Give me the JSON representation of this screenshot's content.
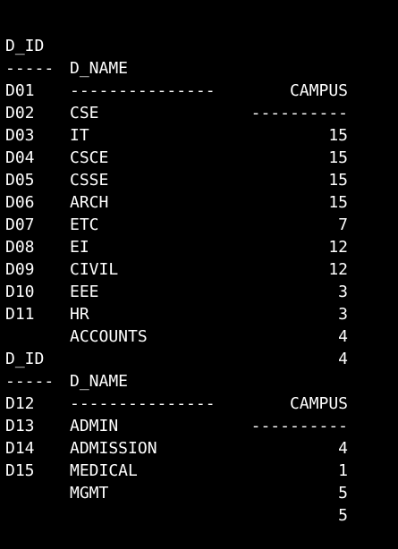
{
  "colors": {
    "background": "#000000",
    "text": "#ffffff"
  },
  "result_sets": [
    {
      "header": {
        "id": "D_ID",
        "name": "D_NAME",
        "campus": "CAMPUS"
      },
      "separator": {
        "id": "-----",
        "name": "---------------",
        "campus": "----------"
      },
      "rows": [
        {
          "id": "D01",
          "name": "CSE",
          "campus": "15"
        },
        {
          "id": "D02",
          "name": "IT",
          "campus": "15"
        },
        {
          "id": "D03",
          "name": "CSCE",
          "campus": "15"
        },
        {
          "id": "D04",
          "name": "CSSE",
          "campus": "15"
        },
        {
          "id": "D05",
          "name": "ARCH",
          "campus": "7"
        },
        {
          "id": "D06",
          "name": "ETC",
          "campus": "12"
        },
        {
          "id": "D07",
          "name": "EI",
          "campus": "12"
        },
        {
          "id": "D08",
          "name": "CIVIL",
          "campus": "3"
        },
        {
          "id": "D09",
          "name": "EEE",
          "campus": "3"
        },
        {
          "id": "D10",
          "name": "HR",
          "campus": "4"
        },
        {
          "id": "D11",
          "name": "ACCOUNTS",
          "campus": "4"
        }
      ]
    },
    {
      "header": {
        "id": "D_ID",
        "name": "D_NAME",
        "campus": "CAMPUS"
      },
      "separator": {
        "id": "-----",
        "name": "---------------",
        "campus": "----------"
      },
      "rows": [
        {
          "id": "D12",
          "name": "ADMIN",
          "campus": "4"
        },
        {
          "id": "D13",
          "name": "ADMISSION",
          "campus": "1"
        },
        {
          "id": "D14",
          "name": "MEDICAL",
          "campus": "5"
        },
        {
          "id": "D15",
          "name": "MGMT",
          "campus": "5"
        }
      ]
    }
  ]
}
